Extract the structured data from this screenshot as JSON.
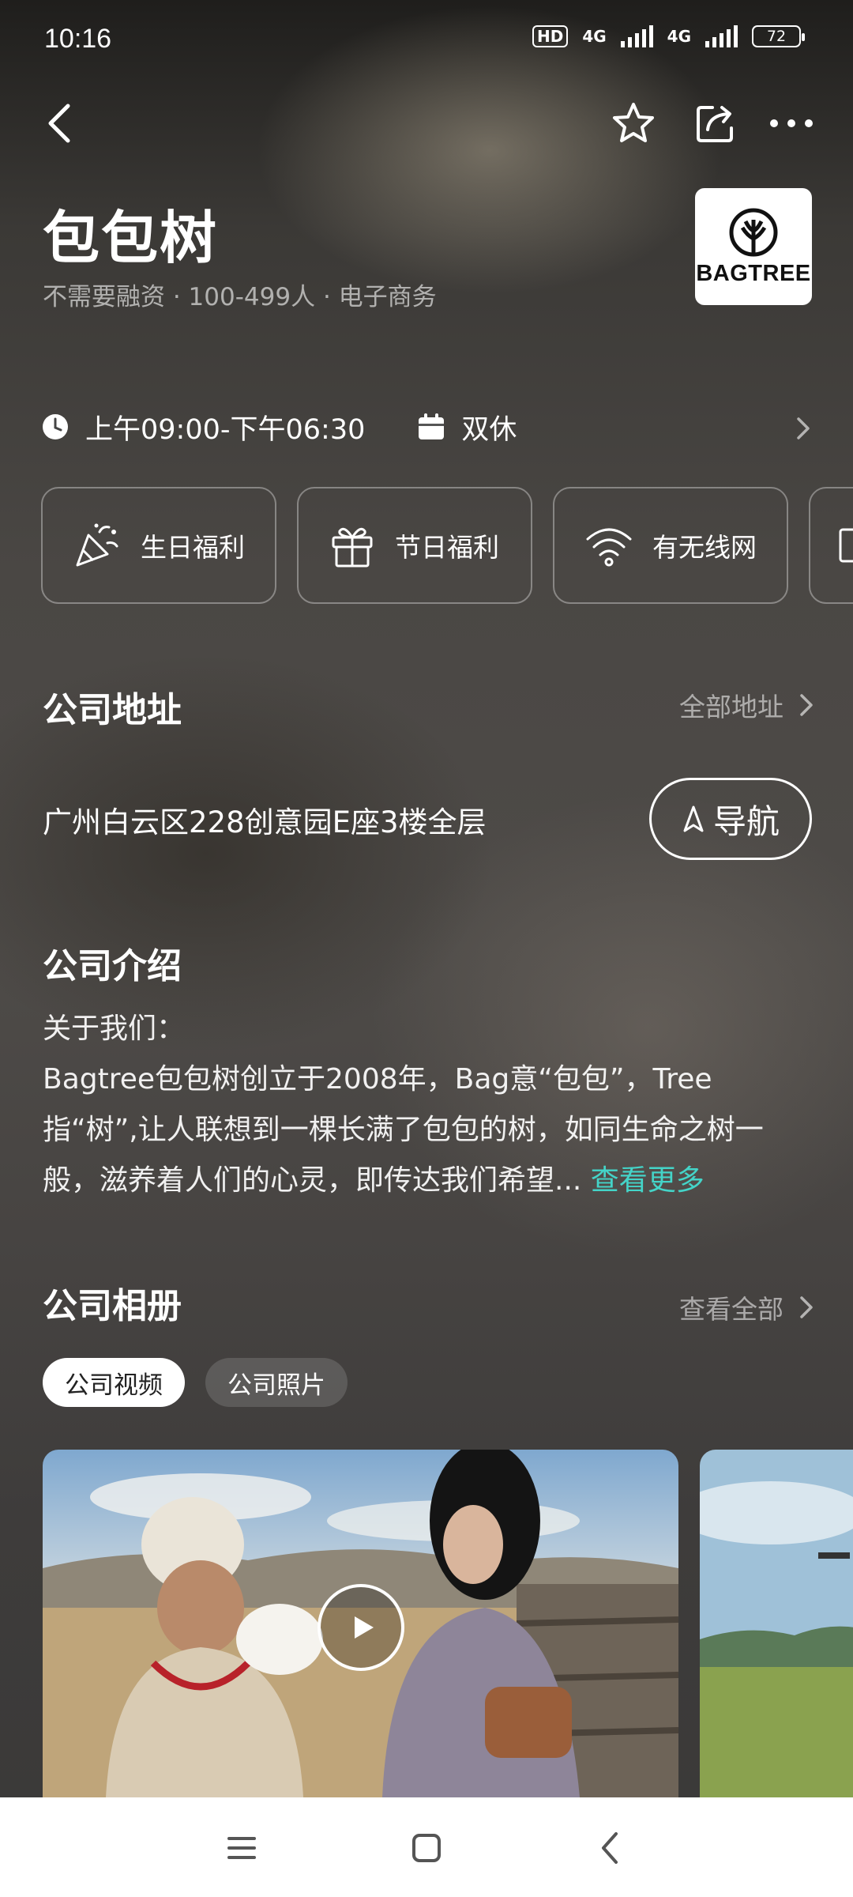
{
  "status_bar": {
    "time": "10:16",
    "hd_label": "HD",
    "network_1": "4G",
    "network_2": "4G",
    "battery": "72"
  },
  "header": {
    "company_name": "包包树",
    "meta": "不需要融资 · 100-499人 · 电子商务",
    "logo_text": "BAGTREE"
  },
  "work_info": {
    "hours": "上午09:00-下午06:30",
    "rest": "双休"
  },
  "benefits": [
    {
      "label": "生日福利",
      "icon": "party-popper-icon"
    },
    {
      "label": "节日福利",
      "icon": "gift-icon"
    },
    {
      "label": "有无线网",
      "icon": "wifi-icon"
    }
  ],
  "address_section": {
    "title": "公司地址",
    "link": "全部地址",
    "address": "广州白云区228创意园E座3楼全层",
    "nav_button": "导航"
  },
  "intro_section": {
    "title": "公司介绍",
    "heading": "关于我们：",
    "body": "Bagtree包包树创立于2008年，Bag意“包包”，Tree指“树”,让人联想到一棵长满了包包的树，如同生命之树一般，滋养着人们的心灵，即传达我们希望...",
    "more": "查看更多"
  },
  "album_section": {
    "title": "公司相册",
    "link": "查看全部",
    "tabs": [
      "公司视频",
      "公司照片"
    ],
    "active_tab": 0
  },
  "colors": {
    "accent": "#44d4c8",
    "background": "#4a4744",
    "bottom_bar": "#ffffff"
  }
}
